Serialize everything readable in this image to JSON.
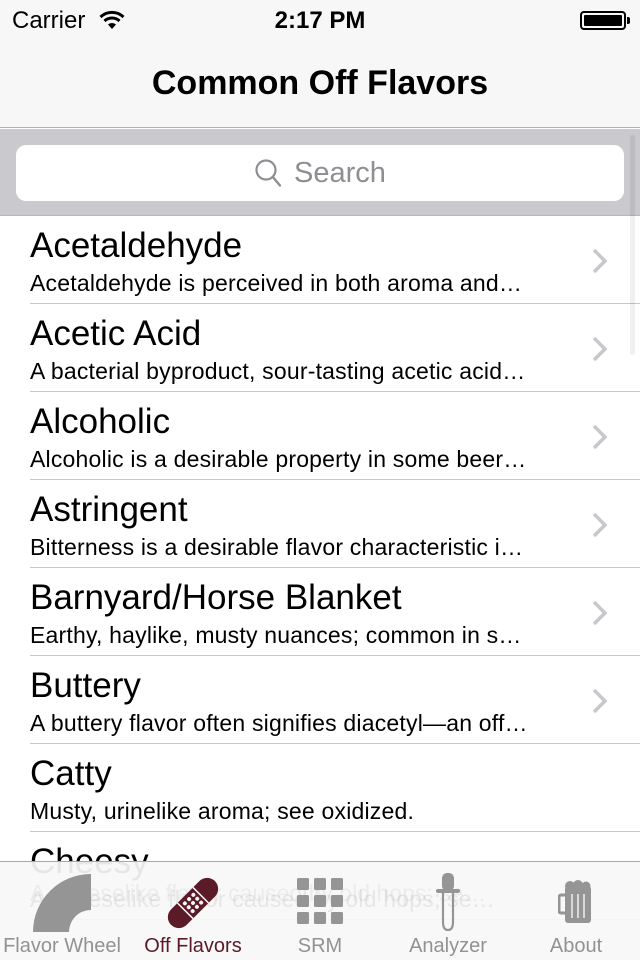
{
  "status_bar": {
    "carrier": "Carrier",
    "time": "2:17 PM",
    "wifi_icon": "wifi-icon",
    "battery_icon": "battery-full-icon"
  },
  "nav": {
    "title": "Common Off Flavors"
  },
  "search": {
    "placeholder": "Search",
    "icon": "search-icon"
  },
  "list": {
    "items": [
      {
        "title": "Acetaldehyde",
        "subtitle": "Acetaldehyde is perceived in both aroma and…",
        "has_chevron": true
      },
      {
        "title": "Acetic Acid",
        "subtitle": "A bacterial byproduct, sour-tasting acetic acid…",
        "has_chevron": true
      },
      {
        "title": "Alcoholic",
        "subtitle": "Alcoholic is a desirable property in some beer…",
        "has_chevron": true
      },
      {
        "title": "Astringent",
        "subtitle": "Bitterness is a desirable flavor characteristic i…",
        "has_chevron": true
      },
      {
        "title": "Barnyard/Horse Blanket",
        "subtitle": "Earthy, haylike, musty nuances; common in s…",
        "has_chevron": true
      },
      {
        "title": "Buttery",
        "subtitle": "A buttery flavor often signifies diacetyl—an off…",
        "has_chevron": true
      },
      {
        "title": "Catty",
        "subtitle": "Musty, urinelike aroma; see oxidized.",
        "has_chevron": false
      },
      {
        "title": "Cheesy",
        "subtitle": "A cheeselike flavor caused by old hops; se…",
        "has_chevron": false
      }
    ]
  },
  "tabbar": {
    "active_color": "#5a1a28",
    "inactive_color": "#929292",
    "tabs": [
      {
        "label": "Flavor Wheel",
        "icon": "flavor-wheel-icon",
        "active": false
      },
      {
        "label": "Off Flavors",
        "icon": "bandage-icon",
        "active": true
      },
      {
        "label": "SRM",
        "icon": "grid-icon",
        "active": false
      },
      {
        "label": "Analyzer",
        "icon": "dropper-icon",
        "active": false
      },
      {
        "label": "About",
        "icon": "beer-mug-icon",
        "active": false
      }
    ]
  }
}
